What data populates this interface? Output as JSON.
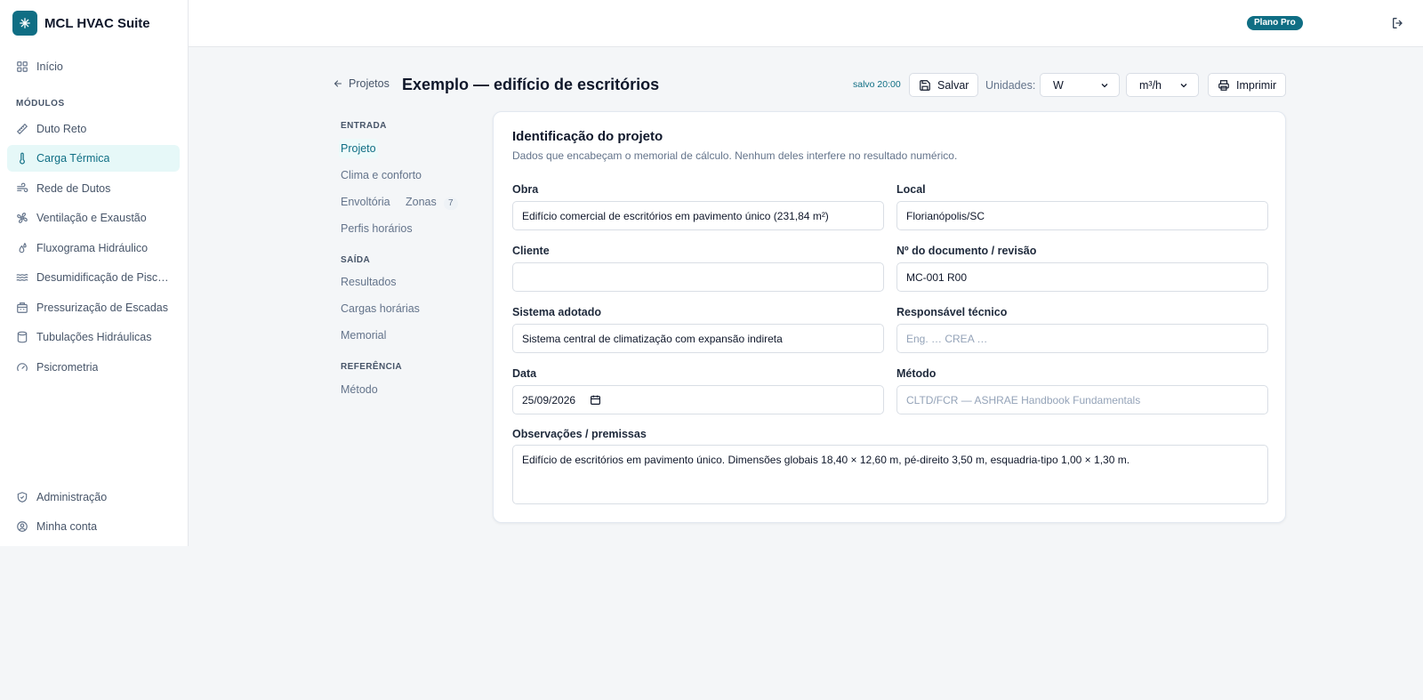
{
  "app": {
    "name": "MCL HVAC Suite"
  },
  "sidebar": {
    "home": "Início",
    "modules_title": "MÓDULOS",
    "modules": [
      {
        "label": "Duto Reto",
        "icon": "ruler-icon"
      },
      {
        "label": "Carga Térmica",
        "icon": "thermometer-icon",
        "active": true
      },
      {
        "label": "Rede de Dutos",
        "icon": "wind-icon"
      },
      {
        "label": "Ventilação e Exaustão",
        "icon": "fan-icon"
      },
      {
        "label": "Fluxograma Hidráulico",
        "icon": "droplets-icon"
      },
      {
        "label": "Desumidificação de Piscin...",
        "icon": "waves-icon"
      },
      {
        "label": "Pressurização de Escadas",
        "icon": "building-icon"
      },
      {
        "label": "Tubulações Hidráulicas",
        "icon": "cylinder-icon"
      },
      {
        "label": "Psicrometria",
        "icon": "gauge-icon"
      }
    ],
    "admin": "Administração",
    "account": "Minha conta"
  },
  "topbar": {
    "plan_badge": "Plano Pro"
  },
  "header": {
    "back": "Projetos",
    "title": "Exemplo — edifício de escritórios",
    "saved": "salvo 20:00",
    "save_label": "Salvar",
    "units_label": "Unidades:",
    "unit_power": "W",
    "unit_flow": "m³/h",
    "print_label": "Imprimir"
  },
  "subnav": {
    "input_title": "ENTRADA",
    "projeto": "Projeto",
    "clima": "Clima e conforto",
    "envoltoria": "Envoltória",
    "zonas": "Zonas",
    "zonas_count": "7",
    "perfis": "Perfis horários",
    "output_title": "SAÍDA",
    "resultados": "Resultados",
    "cargas": "Cargas horárias",
    "memorial": "Memorial",
    "ref_title": "REFERÊNCIA",
    "metodo": "Método"
  },
  "form": {
    "title": "Identificação do projeto",
    "subtitle": "Dados que encabeçam o memorial de cálculo. Nenhum deles interfere no resultado numérico.",
    "obra_label": "Obra",
    "obra_value": "Edifício comercial de escritórios em pavimento único (231,84 m²)",
    "local_label": "Local",
    "local_value": "Florianópolis/SC",
    "cliente_label": "Cliente",
    "cliente_value": "",
    "doc_label": "Nº do documento / revisão",
    "doc_value": "MC-001 R00",
    "sistema_label": "Sistema adotado",
    "sistema_value": "Sistema central de climatização com expansão indireta",
    "resp_label": "Responsável técnico",
    "resp_placeholder": "Eng. … CREA …",
    "data_label": "Data",
    "data_value": "25/09/2026",
    "metodo_label": "Método",
    "metodo_placeholder": "CLTD/FCR — ASHRAE Handbook Fundamentals",
    "obs_label": "Observações / premissas",
    "obs_value": "Edifício de escritórios em pavimento único. Dimensões globais 18,40 × 12,60 m, pé-direito 3,50 m, esquadria-tipo 1,00 × 1,30 m."
  },
  "colors": {
    "accent": "#0f6e84",
    "active_bg": "#e6f8f8"
  }
}
